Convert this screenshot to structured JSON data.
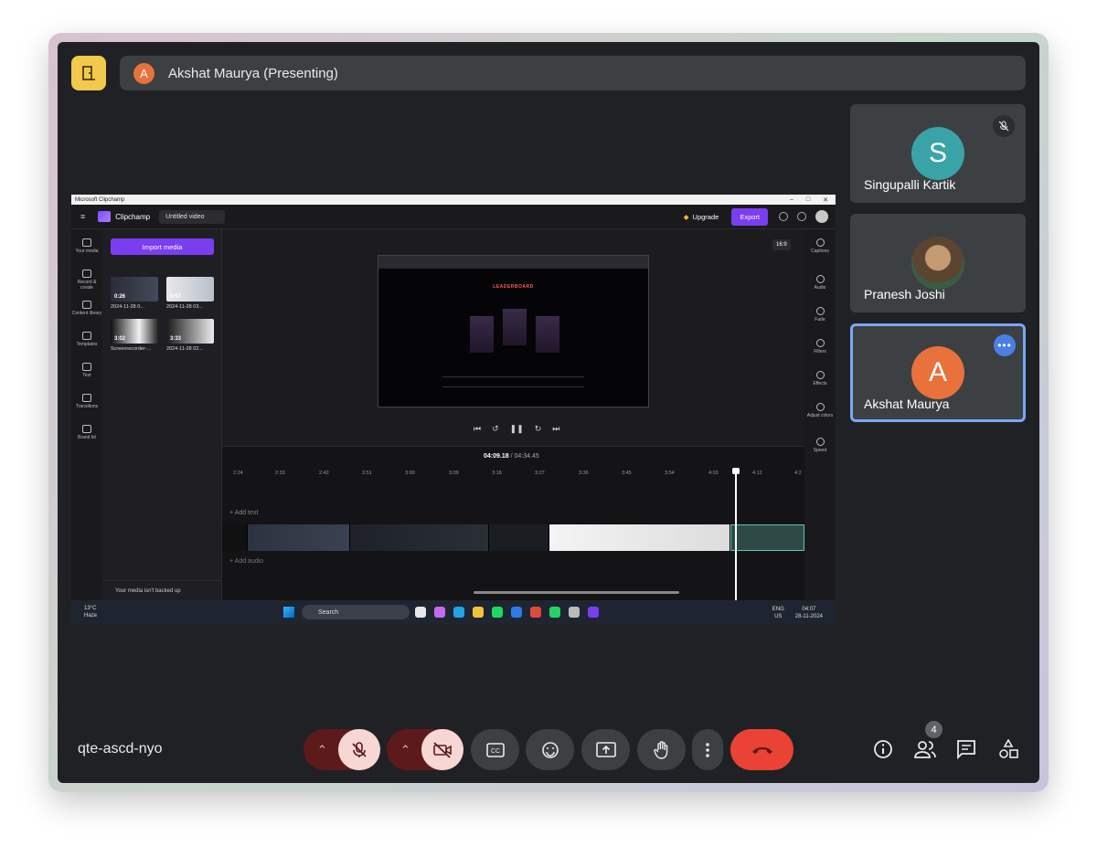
{
  "meeting": {
    "presenter_initial": "A",
    "presenter_label": "Akshat Maurya (Presenting)",
    "meeting_code": "qte-ascd-nyo",
    "participant_count": "4"
  },
  "participants": [
    {
      "initial": "S",
      "name": "Singupalli Kartik",
      "avatar_color": "#3aa3a8",
      "muted": true
    },
    {
      "initial": "",
      "name": "Pranesh Joshi",
      "avatar_color": "#8a6b4a",
      "muted": false
    },
    {
      "initial": "A",
      "name": "Akshat Maurya",
      "avatar_color": "#e8713c",
      "active": true
    }
  ],
  "shared_screen": {
    "window_title": "Microsoft Clipchamp",
    "brand": "Clipchamp",
    "project_name": "Untitled video",
    "upgrade_label": "Upgrade",
    "export_label": "Export",
    "import_label": "Import media",
    "ratio": "16:9",
    "left_nav": [
      "Your media",
      "Record & create",
      "Content library",
      "Templates",
      "Text",
      "Transitions",
      "Brand kit"
    ],
    "right_nav": [
      "Captions",
      "Audio",
      "Fade",
      "Filters",
      "Effects",
      "Adjust colors",
      "Speed"
    ],
    "media": [
      {
        "duration": "0:26",
        "label": "2024-11-28 0..."
      },
      {
        "duration": "0:57",
        "label": "2024-11-28 03..."
      },
      {
        "duration": "3:02",
        "label": "Screenrecorder-..."
      },
      {
        "duration": "3:33",
        "label": "2024-11-28 02..."
      }
    ],
    "backup_notice": "Your media isn't backed up",
    "preview_title": "LEADERBOARD",
    "timecode": "04:09.18",
    "total": "/ 04:34.45",
    "ruler_ticks": [
      "2:24",
      "2:33",
      "2:42",
      "2:51",
      "3:00",
      "3:09",
      "3:18",
      "3:27",
      "3:36",
      "3:45",
      "3:54",
      "4:03",
      "4:12",
      "4:2"
    ],
    "add_text": "+ Add text",
    "add_audio": "+ Add audio",
    "taskbar": {
      "temp": "13°C",
      "weather": "Haze",
      "search": "Search",
      "lang1": "ENG",
      "lang2": "US",
      "time": "04:07",
      "date": "28-11-2024"
    }
  },
  "colors": {
    "accent": "#7a3ef0",
    "end_call": "#ea4335",
    "exit_tile": "#f2c94c"
  }
}
